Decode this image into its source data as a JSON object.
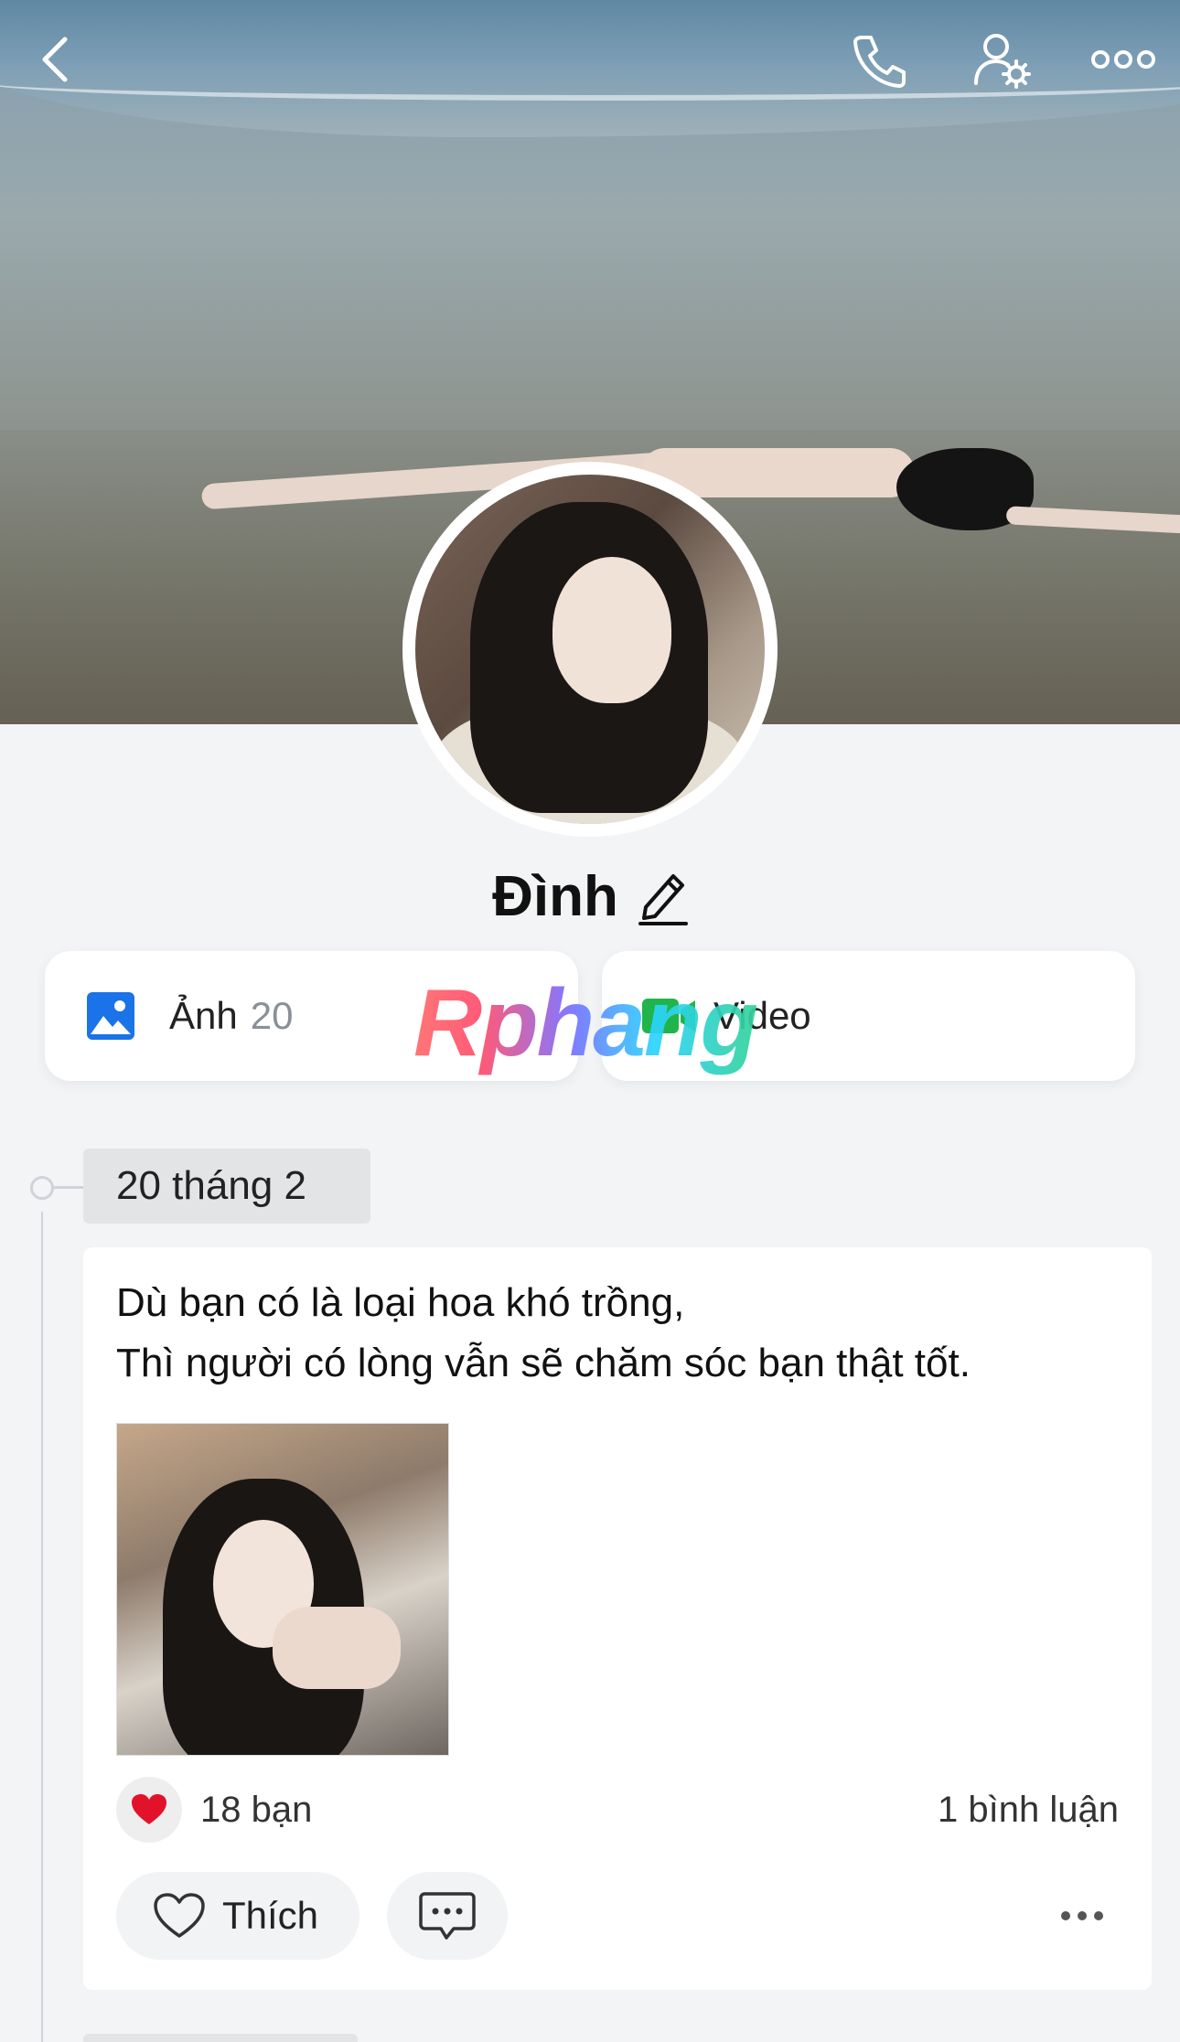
{
  "profile": {
    "name": "Đình"
  },
  "media": {
    "photos_label": "Ảnh",
    "photos_count": "20",
    "video_label": "Video"
  },
  "watermark": "Rphang",
  "timeline": {
    "date": "20 tháng 2"
  },
  "post": {
    "line1": "Dù bạn có là loại hoa khó trồng,",
    "line2": "Thì người có lòng vẫn sẽ chăm sóc bạn thật tốt.",
    "reaction_count": "18 bạn",
    "comment_count": "1 bình luận",
    "like_label": "Thích"
  },
  "colors": {
    "background": "#f3f4f6",
    "heart": "#e3122b",
    "photo_icon": "#1a73e8",
    "video_icon": "#20b44a"
  },
  "icons": {
    "back": "chevron-left-icon",
    "call": "phone-icon",
    "settings": "user-settings-icon",
    "more": "more-horizontal-icon",
    "edit": "pencil-icon"
  }
}
